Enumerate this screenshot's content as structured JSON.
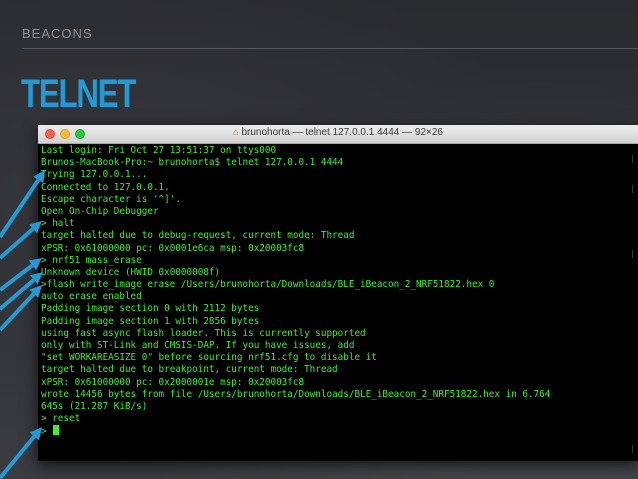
{
  "slide": {
    "section": "BEACONS",
    "title": "TELNET",
    "accent_color": "#1f9bd7"
  },
  "window": {
    "title": "brunohorta — telnet 127.0.0.1 4444 — 92×26",
    "title_icon": "home-folder-icon"
  },
  "terminal": {
    "text_color": "#3df02f",
    "lines": [
      "Last login: Fri Oct 27 13:51:37 on ttys000",
      "Brunos-MacBook-Pro:~ brunohorta$ telnet 127.0.0.1 4444",
      "Trying 127.0.0.1...",
      "Connected to 127.0.0.1.",
      "Escape character is '^]'.",
      "Open On-Chip Debugger",
      "> halt",
      "target halted due to debug-request, current mode: Thread",
      "xPSR: 0x61000000 pc: 0x0001e6ca msp: 0x20003fc8",
      "> nrf51 mass_erase",
      "Unknown device (HWID 0x0000008f)",
      ">flash write_image erase /Users/brunohorta/Downloads/BLE_iBeacon_2_NRF51822.hex 0",
      "auto erase enabled",
      "Padding image section 0 with 2112 bytes",
      "Padding image section 1 with 2856 bytes",
      "using fast async flash loader. This is currently supported",
      "only with ST-Link and CMSIS-DAP. If you have issues, add",
      "\"set WORKAREASIZE 0\" before sourcing nrf51.cfg to disable it",
      "target halted due to breakpoint, current mode: Thread",
      "xPSR: 0x61000000 pc: 0x2000001e msp: 0x20003fc8",
      "wrote 14456 bytes from file /Users/brunohorta/Downloads/BLE_iBeacon_2_NRF51822.hex in 6.764",
      "645s (21.287 KiB/s)",
      "> reset",
      ">"
    ]
  }
}
